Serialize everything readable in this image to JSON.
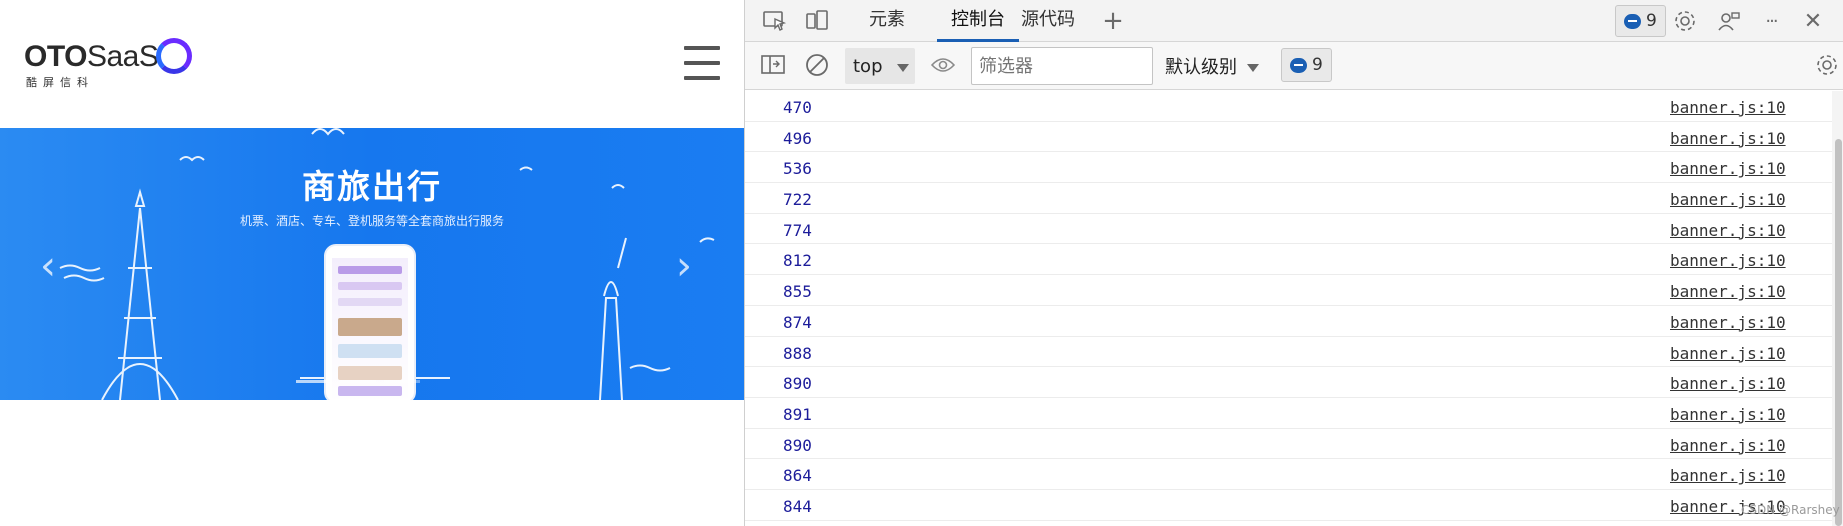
{
  "site": {
    "logo": {
      "bold": "OTO",
      "light": "SaaS",
      "sub": "酷屏信科"
    },
    "banner": {
      "title": "商旅出行",
      "subtitle": "机票、酒店、专车、登机服务等全套商旅出行服务",
      "prev": "‹",
      "next": "›"
    }
  },
  "devtools": {
    "tabs": [
      {
        "label": "元素",
        "active": false
      },
      {
        "label": "控制台",
        "active": true
      },
      {
        "label": "源代码",
        "active": false
      }
    ],
    "add_tab": "+",
    "message_count": "9",
    "more": "···",
    "close": "✕",
    "toolbar": {
      "context": "top",
      "filter_placeholder": "筛选器",
      "levels": "默认级别",
      "message_count": "9"
    },
    "console_rows": [
      {
        "value": "470",
        "source": "banner.js:10"
      },
      {
        "value": "496",
        "source": "banner.js:10"
      },
      {
        "value": "536",
        "source": "banner.js:10"
      },
      {
        "value": "722",
        "source": "banner.js:10"
      },
      {
        "value": "774",
        "source": "banner.js:10"
      },
      {
        "value": "812",
        "source": "banner.js:10"
      },
      {
        "value": "855",
        "source": "banner.js:10"
      },
      {
        "value": "874",
        "source": "banner.js:10"
      },
      {
        "value": "888",
        "source": "banner.js:10"
      },
      {
        "value": "890",
        "source": "banner.js:10"
      },
      {
        "value": "891",
        "source": "banner.js:10"
      },
      {
        "value": "890",
        "source": "banner.js:10"
      },
      {
        "value": "864",
        "source": "banner.js:10"
      },
      {
        "value": "844",
        "source": "banner.js:10"
      }
    ],
    "watermark": "CSDN @Rarshey"
  }
}
